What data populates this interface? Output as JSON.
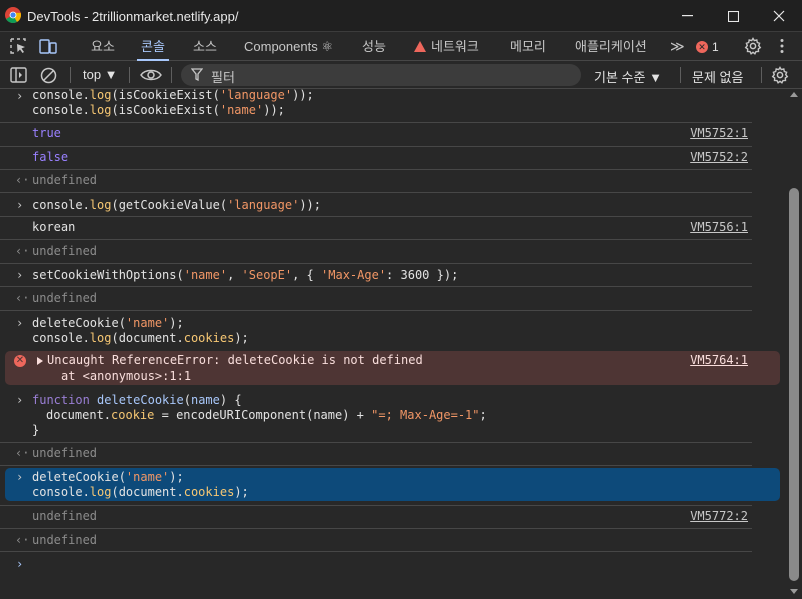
{
  "window": {
    "title": "DevTools - 2trillionmarket.netlify.app/",
    "minimize": "—",
    "maximize": "☐",
    "close": "✕"
  },
  "tabs": [
    {
      "label": "요소"
    },
    {
      "label": "콘솔"
    },
    {
      "label": "소스"
    },
    {
      "label": "Components ⚛"
    },
    {
      "label": "성능"
    },
    {
      "label": "네트워크"
    },
    {
      "label": "메모리"
    },
    {
      "label": "애플리케이션"
    }
  ],
  "tab_more": "≫",
  "error_count": "1",
  "toolbar": {
    "context": "top ▼",
    "filter_placeholder": "필터",
    "level": "기본 수준 ▼",
    "issues": "문제 없음"
  },
  "console": {
    "lines": {
      "l1a": "console.log(isCookieExist('language'));",
      "l1b": "console.log(isCookieExist('name'));",
      "o1": "true",
      "o1src": "VM5752:1",
      "o2": "false",
      "o2src": "VM5752:2",
      "r1": "undefined",
      "l2": "console.log(getCookieValue('language'));",
      "o3": "korean",
      "o3src": "VM5756:1",
      "r2": "undefined",
      "l3": "setCookieWithOptions('name', 'SeopE', { 'Max-Age': 3600 });",
      "r3": "undefined",
      "l4a": "deleteCookie('name');",
      "l4b": "console.log(document.cookies);",
      "err1": "Uncaught ReferenceError: deleteCookie is not defined",
      "err2": "at <anonymous>:1:1",
      "errsrc": "VM5764:1",
      "l5a": "function deleteCookie(name) {",
      "l5b": "document.cookie = encodeURIComponent(name) + \"=; Max-Age=-1\";",
      "l5c": "}",
      "r4": "undefined",
      "l6a": "deleteCookie('name');",
      "l6b": "console.log(document.cookies);",
      "o4": "undefined",
      "o4src": "VM5772:2",
      "r5": "undefined"
    }
  }
}
